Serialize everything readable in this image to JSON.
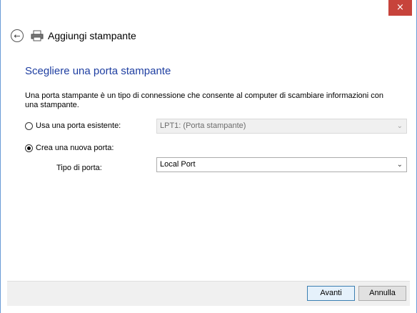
{
  "window": {
    "close_glyph": "×"
  },
  "header": {
    "title": "Aggiungi stampante",
    "back_icon": "back-arrow-icon",
    "printer_icon": "printer-icon"
  },
  "content": {
    "heading": "Scegliere una porta stampante",
    "description": "Una porta stampante è un tipo di connessione che consente al computer di scambiare informazioni con una stampante.",
    "existing_port": {
      "label": "Usa una porta esistente:",
      "selected": false,
      "value": "LPT1: (Porta stampante)"
    },
    "new_port": {
      "label": "Crea una nuova porta:",
      "selected": true
    },
    "port_type": {
      "label": "Tipo di porta:",
      "value": "Local Port"
    }
  },
  "footer": {
    "next_label": "Avanti",
    "cancel_label": "Annulla"
  },
  "colors": {
    "heading": "#1e3ea1",
    "close": "#c7433b"
  }
}
